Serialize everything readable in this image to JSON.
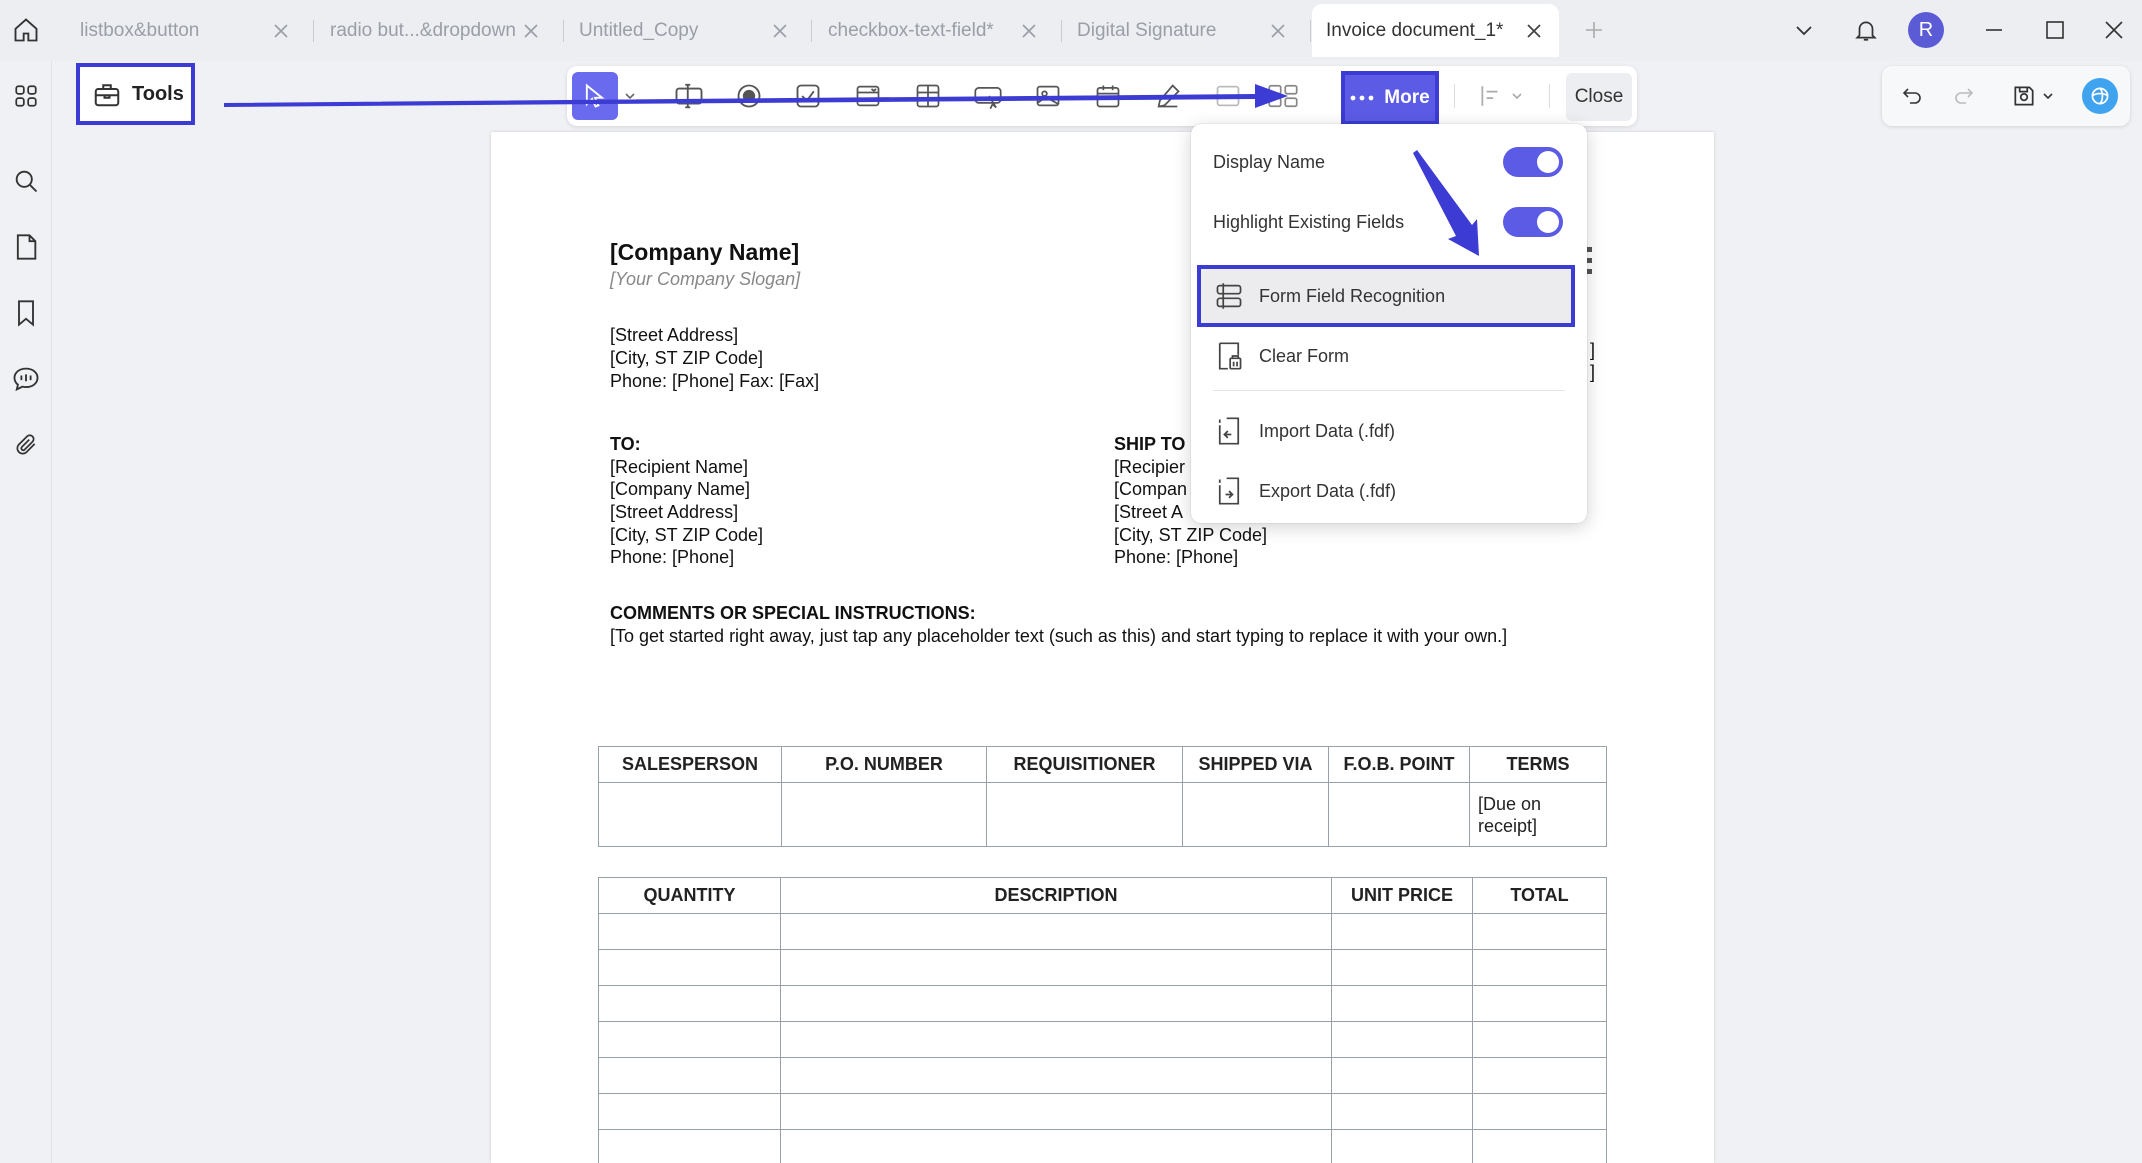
{
  "tabs": [
    {
      "label": "listbox&button",
      "active": false
    },
    {
      "label": "radio but...&dropdown",
      "active": false
    },
    {
      "label": "Untitled_Copy",
      "active": false
    },
    {
      "label": "checkbox-text-field*",
      "active": false
    },
    {
      "label": "Digital Signature",
      "active": false
    },
    {
      "label": "Invoice document_1*",
      "active": true
    }
  ],
  "user": {
    "avatar_initial": "R"
  },
  "tools": {
    "label": "Tools"
  },
  "toolbar": {
    "more_label": "More",
    "close_label": "Close"
  },
  "menu": {
    "display_name": "Display Name",
    "highlight_fields": "Highlight Existing Fields",
    "form_field_recognition": "Form Field Recognition",
    "clear_form": "Clear Form",
    "import_data": "Import Data (.fdf)",
    "export_data": "Export Data (.fdf)",
    "display_name_on": true,
    "highlight_fields_on": true
  },
  "document": {
    "company_name": "[Company Name]",
    "slogan": "[Your Company Slogan]",
    "street": "[Street Address]",
    "city": "[City, ST ZIP Code]",
    "phone_fax": "Phone: [Phone]  Fax: [Fax]",
    "to_label": "TO:",
    "to_lines": [
      "[Recipient Name]",
      "[Company Name]",
      "[Street Address]",
      "[City, ST ZIP Code]",
      "Phone: [Phone]"
    ],
    "ship_to_label": "SHIP TO",
    "ship_to_lines": [
      "[Recipier",
      "[Compan",
      "[Street A",
      "[City, ST ZIP Code]",
      "Phone: [Phone]"
    ],
    "right_edge_fragments": [
      "]",
      "]"
    ],
    "comments_label": "COMMENTS OR SPECIAL INSTRUCTIONS:",
    "comments_text": "[To get started right away, just tap any placeholder text (such as this) and start typing to replace it with your own.]",
    "table1_headers": [
      "SALESPERSON",
      "P.O. NUMBER",
      "REQUISITIONER",
      "SHIPPED VIA",
      "F.O.B. POINT",
      "TERMS"
    ],
    "table1_row": [
      "",
      "",
      "",
      "",
      "",
      "[Due on receipt]"
    ],
    "table2_headers": [
      "QUANTITY",
      "DESCRIPTION",
      "UNIT PRICE",
      "TOTAL"
    ]
  },
  "colors": {
    "accent": "#5b5be6",
    "highlight_border": "#3c3bd3"
  }
}
